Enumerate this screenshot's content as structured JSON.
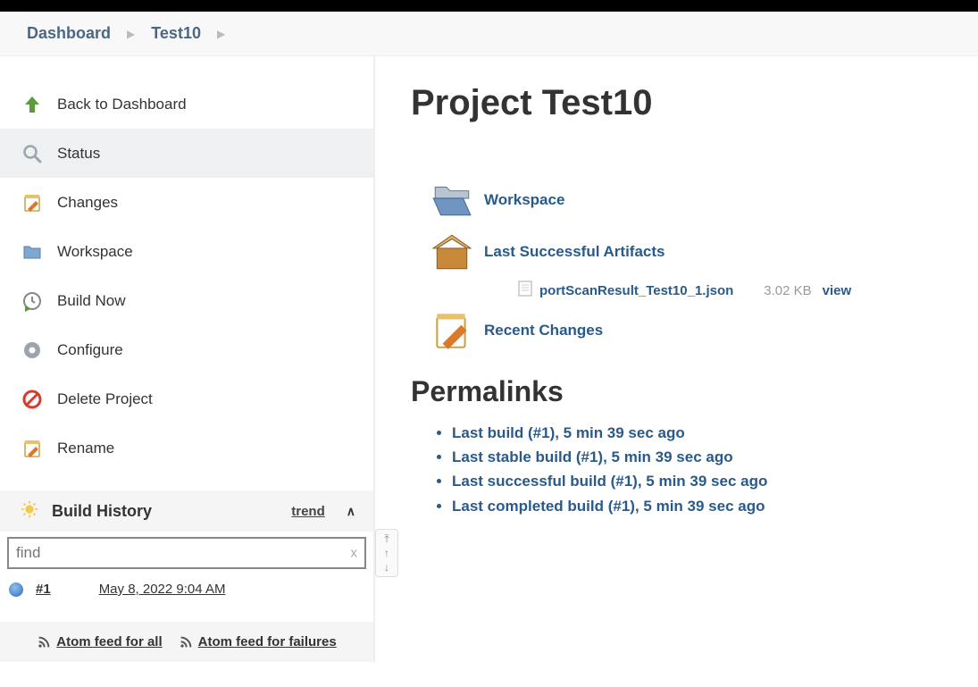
{
  "breadcrumb": {
    "dashboard": "Dashboard",
    "project": "Test10"
  },
  "sidebar": {
    "items": [
      {
        "label": "Back to Dashboard"
      },
      {
        "label": "Status"
      },
      {
        "label": "Changes"
      },
      {
        "label": "Workspace"
      },
      {
        "label": "Build Now"
      },
      {
        "label": "Configure"
      },
      {
        "label": "Delete Project"
      },
      {
        "label": "Rename"
      }
    ]
  },
  "build_history": {
    "title": "Build History",
    "trend_label": "trend",
    "find_placeholder": "find",
    "clear_glyph": "x",
    "builds": [
      {
        "number": "#1",
        "datetime": "May 8, 2022 9:04 AM"
      }
    ]
  },
  "feeds": {
    "all": "Atom feed for all",
    "failures": "Atom feed for failures"
  },
  "page": {
    "title": "Project Test10",
    "workspace_label": "Workspace",
    "artifacts_label": "Last Successful Artifacts",
    "artifact": {
      "name": "portScanResult_Test10_1.json",
      "size": "3.02 KB",
      "view": "view"
    },
    "recent_changes": "Recent Changes",
    "permalinks_heading": "Permalinks",
    "permalinks": [
      "Last build (#1), 5 min 39 sec ago",
      "Last stable build (#1), 5 min 39 sec ago",
      "Last successful build (#1), 5 min 39 sec ago",
      "Last completed build (#1), 5 min 39 sec ago"
    ]
  }
}
